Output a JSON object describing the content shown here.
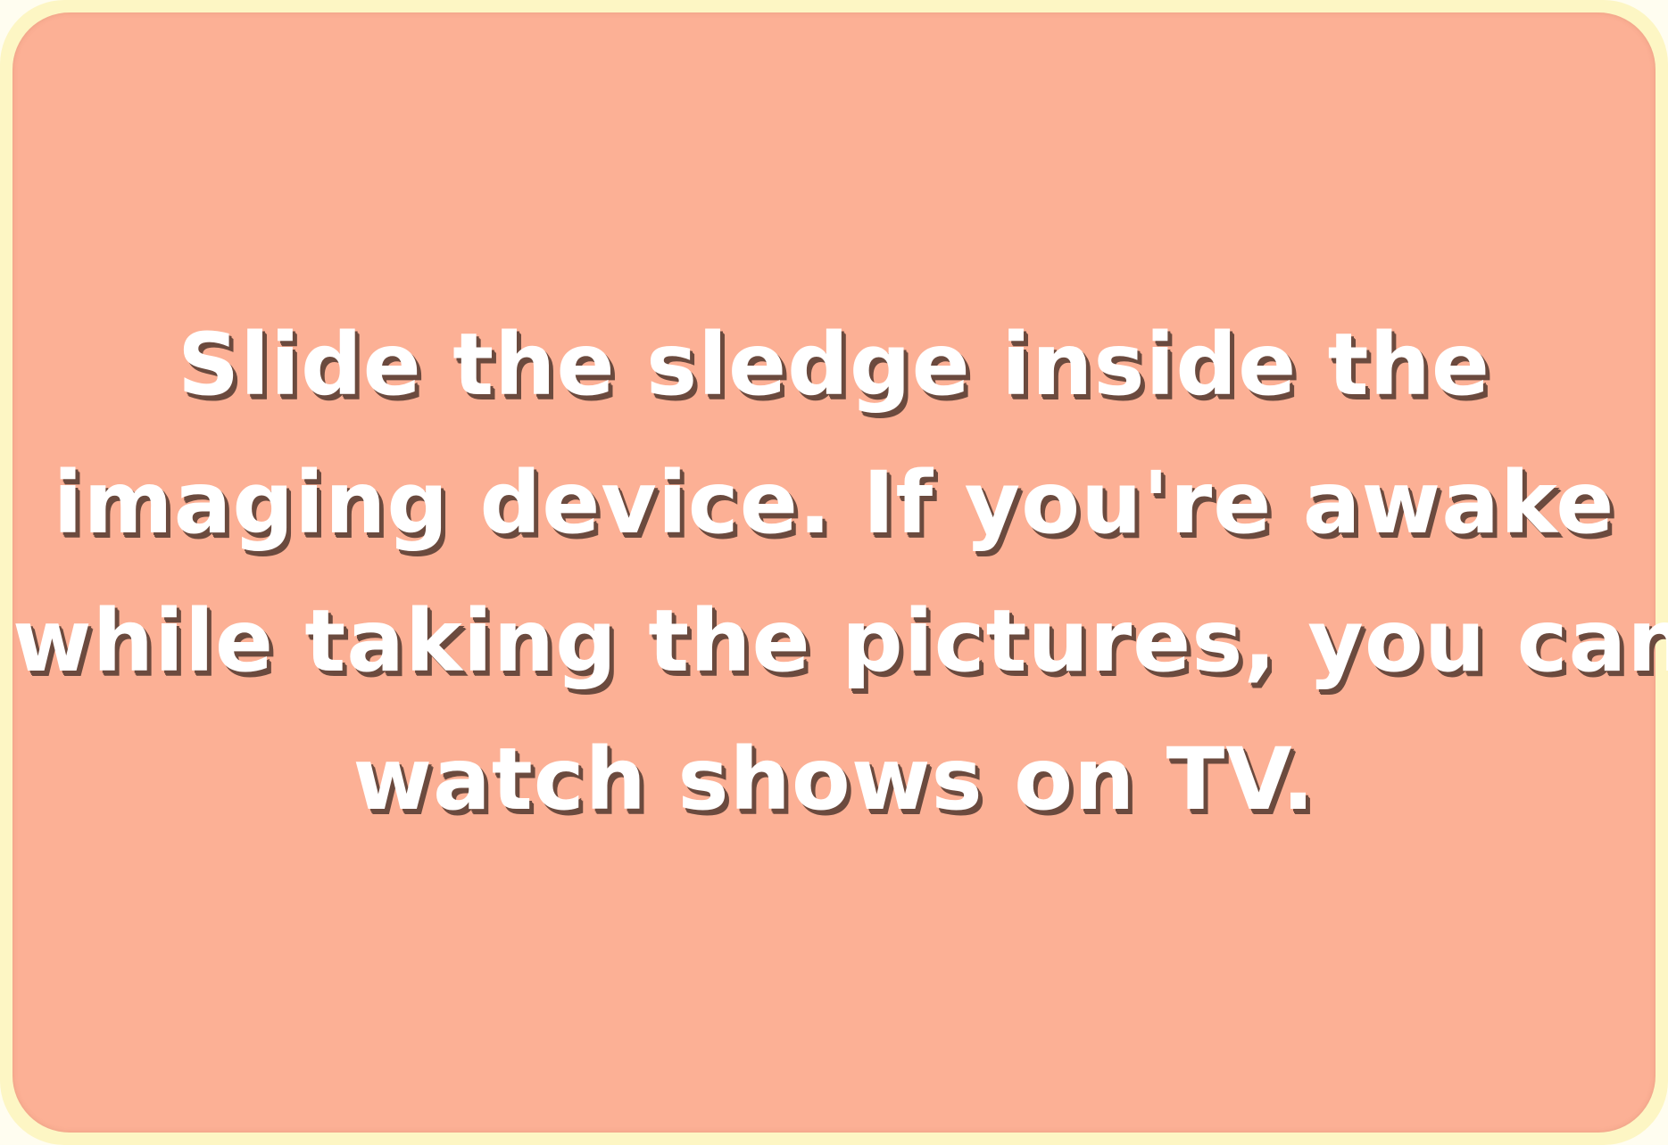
{
  "card": {
    "background_color": "#fcb095",
    "border_color": "#fdf6c4",
    "text_color": "#ffffff",
    "shadow_color": "#6b4a3e",
    "lines": [
      "Slide the sledge inside the",
      "imaging device. If you're awake",
      "while taking the pictures, you can",
      "watch shows on TV."
    ]
  }
}
